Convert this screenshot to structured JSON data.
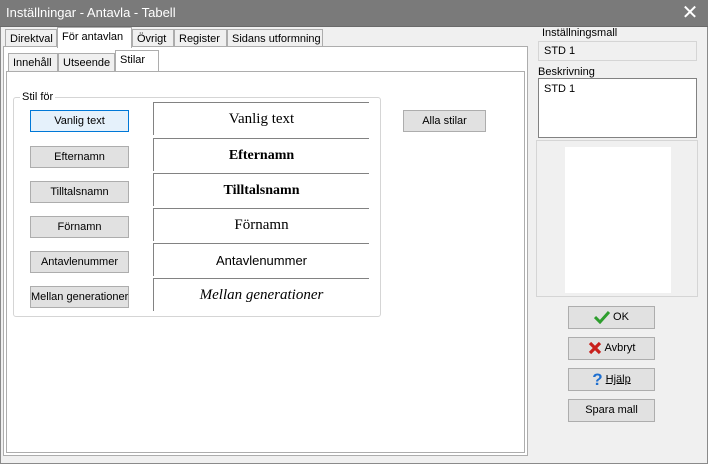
{
  "window": {
    "title": "Inställningar - Antavla - Tabell",
    "close_glyph": "✕"
  },
  "tabs": [
    {
      "label": "Direktval"
    },
    {
      "label": "För antavlan"
    },
    {
      "label": "Övrigt"
    },
    {
      "label": "Register"
    },
    {
      "label": "Sidans utformning"
    }
  ],
  "subtabs": [
    {
      "label": "Innehåll"
    },
    {
      "label": "Utseende"
    },
    {
      "label": "Stilar"
    }
  ],
  "styles_group": {
    "label": "Stil för",
    "rows": [
      {
        "button": "Vanlig text",
        "preview": "Vanlig text"
      },
      {
        "button": "Efternamn",
        "preview": "Efternamn"
      },
      {
        "button": "Tilltalsnamn",
        "preview": "Tilltalsnamn"
      },
      {
        "button": "Förnamn",
        "preview": "Förnamn"
      },
      {
        "button": "Antavlenummer",
        "preview": "Antavlenummer"
      },
      {
        "button": "Mellan generationer",
        "preview": "Mellan generationer"
      }
    ]
  },
  "all_styles_button": "Alla stilar",
  "sidebar": {
    "template_label": "Inställningsmall",
    "template_value": "STD 1",
    "description_label": "Beskrivning",
    "description_value": "STD 1"
  },
  "actions": {
    "ok": "OK",
    "cancel": "Avbryt",
    "help": "Hjälp",
    "save_template": "Spara mall"
  },
  "colors": {
    "ok_check": "#2e9e2e",
    "cancel_x": "#c8201c",
    "help_question": "#1e6fd0"
  }
}
